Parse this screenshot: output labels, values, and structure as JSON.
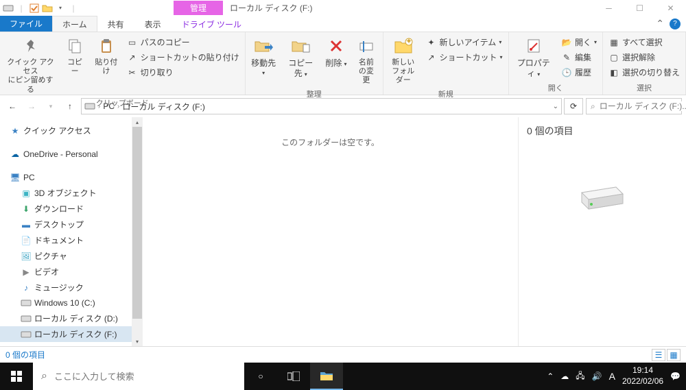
{
  "titlebar": {
    "context_tab": "管理",
    "title": "ローカル ディスク (F:)"
  },
  "tabs": {
    "file": "ファイル",
    "home": "ホーム",
    "share": "共有",
    "view": "表示",
    "drive_tools": "ドライブ ツール"
  },
  "ribbon": {
    "pin": "クイック アクセス\nにピン留めする",
    "copy": "コピー",
    "paste": "貼り付け",
    "cut": "切り取り",
    "copy_path": "パスのコピー",
    "paste_shortcut": "ショートカットの貼り付け",
    "group_clipboard": "クリップボード",
    "move_to": "移動先",
    "copy_to": "コピー先",
    "delete": "削除",
    "rename": "名前\nの変更",
    "group_organize": "整理",
    "new_folder": "新しい\nフォルダー",
    "new_item": "新しいアイテム",
    "shortcut": "ショートカット",
    "group_new": "新規",
    "properties": "プロパティ",
    "open": "開く",
    "edit": "編集",
    "history": "履歴",
    "group_open": "開く",
    "select_all": "すべて選択",
    "select_none": "選択解除",
    "invert": "選択の切り替え",
    "group_select": "選択"
  },
  "breadcrumb": {
    "pc": "PC",
    "drive": "ローカル ディスク (F:)"
  },
  "search": {
    "placeholder": "ローカル ディスク (F:)..."
  },
  "nav": {
    "quick_access": "クイック アクセス",
    "onedrive": "OneDrive - Personal",
    "pc": "PC",
    "obj3d": "3D オブジェクト",
    "downloads": "ダウンロード",
    "desktop": "デスクトップ",
    "documents": "ドキュメント",
    "pictures": "ピクチャ",
    "videos": "ビデオ",
    "music": "ミュージック",
    "drive_c": "Windows 10 (C:)",
    "drive_d": "ローカル ディスク (D:)",
    "drive_f": "ローカル ディスク (F:)"
  },
  "content": {
    "empty": "このフォルダーは空です。"
  },
  "preview": {
    "title": "0 個の項目"
  },
  "status": {
    "items": "0 個の項目"
  },
  "taskbar": {
    "search_placeholder": "ここに入力して検索",
    "ime": "A",
    "time": "19:14",
    "date": "2022/02/06"
  }
}
